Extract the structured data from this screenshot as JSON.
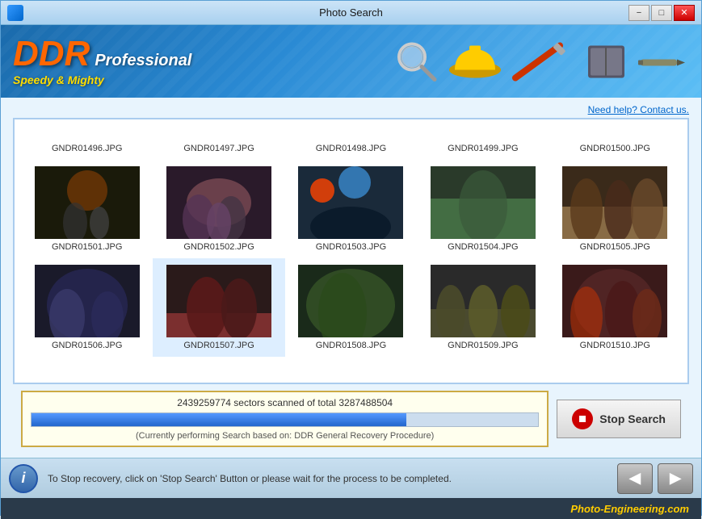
{
  "titlebar": {
    "title": "Photo Search",
    "minimize": "−",
    "restore": "□",
    "close": "✕"
  },
  "header": {
    "logo_ddr": "DDR",
    "logo_professional": "Professional",
    "tagline": "Speedy & Mighty"
  },
  "help_link": "Need help? Contact us.",
  "photos": {
    "row1": [
      {
        "name": "GNDR01496.JPG",
        "thumb_class": "thumb-1"
      },
      {
        "name": "GNDR01497.JPG",
        "thumb_class": "thumb-2"
      },
      {
        "name": "GNDR01498.JPG",
        "thumb_class": "thumb-3"
      },
      {
        "name": "GNDR01499.JPG",
        "thumb_class": "thumb-4"
      },
      {
        "name": "GNDR01500.JPG",
        "thumb_class": "thumb-5"
      }
    ],
    "row2": [
      {
        "name": "GNDR01501.JPG",
        "thumb_class": "thumb-6"
      },
      {
        "name": "GNDR01502.JPG",
        "thumb_class": "thumb-7"
      },
      {
        "name": "GNDR01503.JPG",
        "thumb_class": "thumb-8"
      },
      {
        "name": "GNDR01504.JPG",
        "thumb_class": "thumb-9"
      },
      {
        "name": "GNDR01505.JPG",
        "thumb_class": "thumb-10"
      }
    ],
    "row3": [
      {
        "name": "GNDR01506.JPG",
        "thumb_class": "thumb-2"
      },
      {
        "name": "GNDR01507.JPG",
        "thumb_class": "thumb-7"
      },
      {
        "name": "GNDR01508.JPG",
        "thumb_class": "thumb-3"
      },
      {
        "name": "GNDR01509.JPG",
        "thumb_class": "thumb-9"
      },
      {
        "name": "GNDR01510.JPG",
        "thumb_class": "thumb-5"
      }
    ]
  },
  "progress": {
    "sectors_text": "2439259774 sectors scanned of total 3287488504",
    "fill_percent": 74,
    "subtitle": "(Currently performing Search based on:  DDR General Recovery Procedure)",
    "stop_button_label": "Stop Search"
  },
  "status": {
    "message": "To Stop recovery, click on 'Stop Search' Button or please wait for the process to be completed."
  },
  "footer": {
    "brand": "Photo-Engineering.com"
  }
}
